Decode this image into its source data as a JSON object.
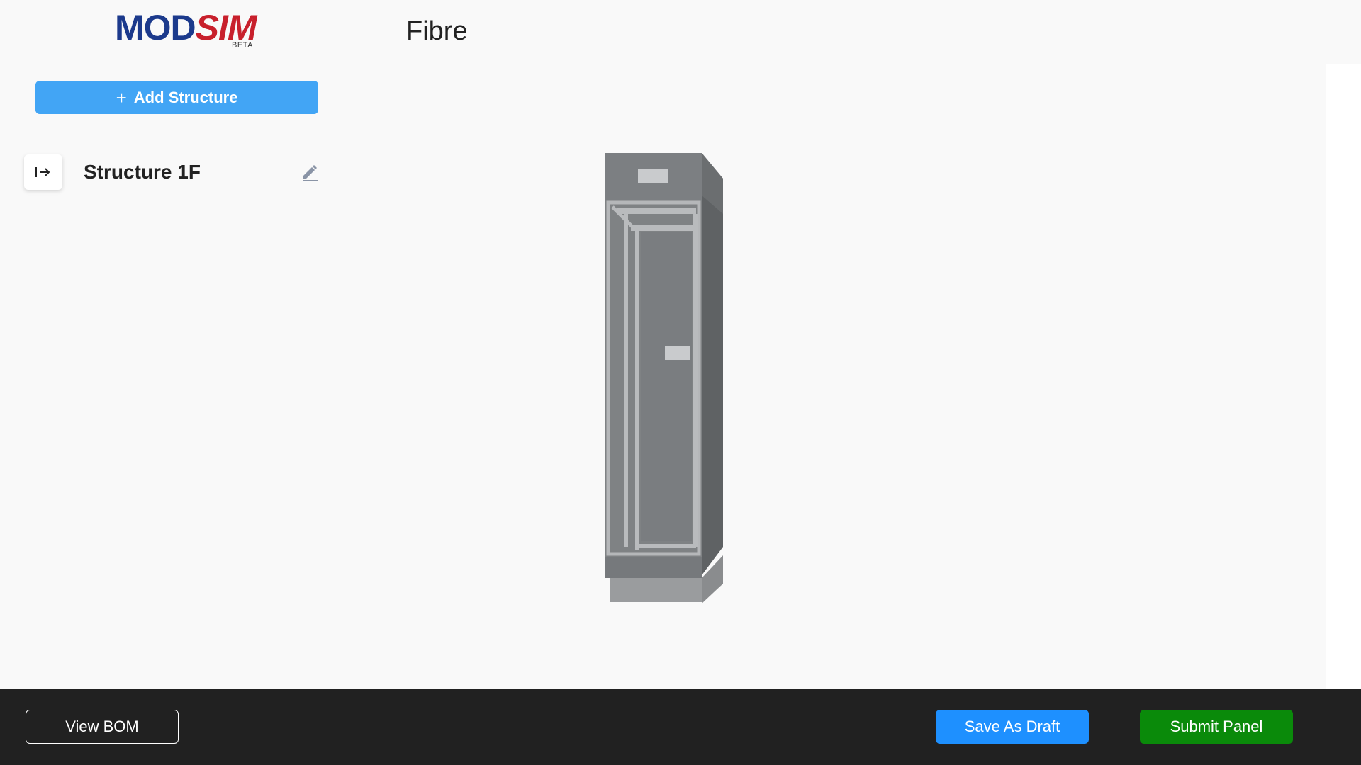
{
  "logo": {
    "primary": "MOD",
    "accent": "SIM",
    "tag": "BETA"
  },
  "page": {
    "title": "Fibre"
  },
  "sidebar": {
    "add_button_label": "Add Structure",
    "structures": [
      {
        "label": "Structure 1F"
      }
    ]
  },
  "footer": {
    "view_bom_label": "View BOM",
    "save_draft_label": "Save As Draft",
    "submit_label": "Submit Panel"
  },
  "colors": {
    "brand_blue": "#1c3a8c",
    "brand_red": "#c8202c",
    "add_button": "#42a5f5",
    "save_draft": "#1e90ff",
    "submit": "#0a8a0a",
    "footer_bg": "#212121"
  },
  "icons": {
    "add": "plus-icon",
    "collapse": "arrow-right-bar-icon",
    "edit": "pencil-icon"
  }
}
